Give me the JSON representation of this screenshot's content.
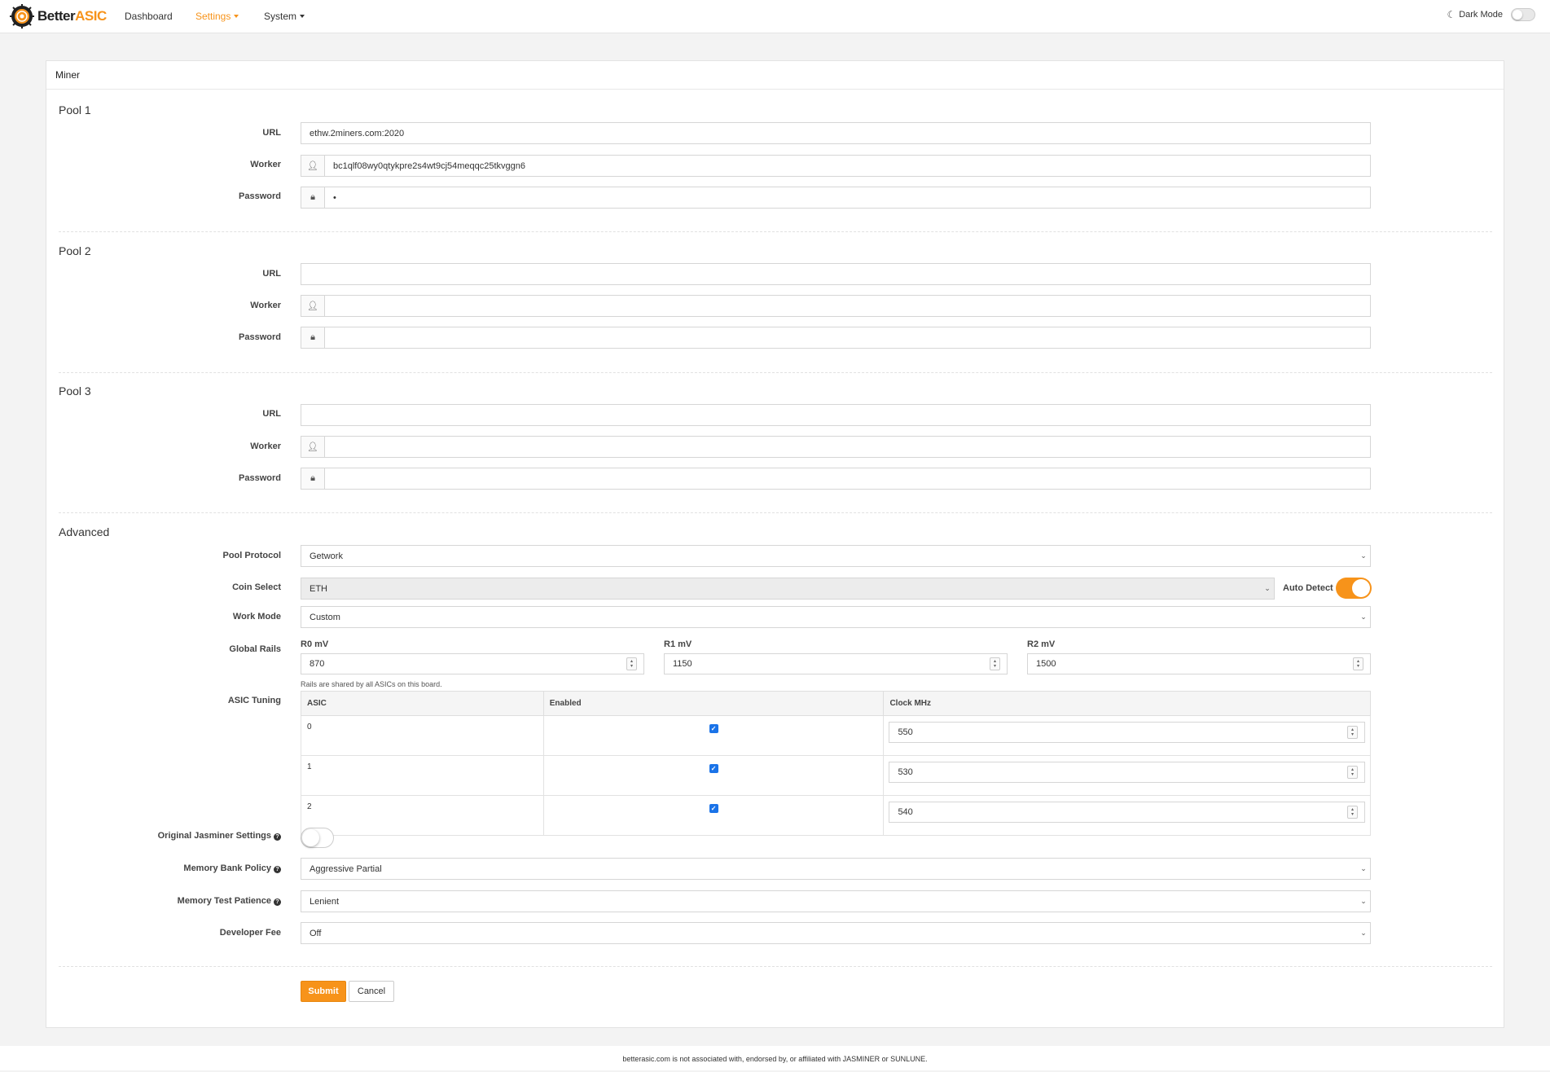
{
  "brand": {
    "name_part1": "Better",
    "name_part2": "ASIC"
  },
  "nav": {
    "dashboard": "Dashboard",
    "settings": "Settings",
    "system": "System",
    "dark_mode": "Dark Mode"
  },
  "card": {
    "title": "Miner"
  },
  "labels": {
    "url": "URL",
    "worker": "Worker",
    "password": "Password"
  },
  "pools": [
    {
      "title": "Pool 1",
      "url": "ethw.2miners.com:2020",
      "worker": "bc1qlf08wy0qtykpre2s4wt9cj54meqqc25tkvggn6",
      "password": "•"
    },
    {
      "title": "Pool 2",
      "url": "",
      "worker": "",
      "password": ""
    },
    {
      "title": "Pool 3",
      "url": "",
      "worker": "",
      "password": ""
    }
  ],
  "advanced": {
    "title": "Advanced",
    "pool_protocol": {
      "label": "Pool Protocol",
      "value": "Getwork"
    },
    "coin_select": {
      "label": "Coin Select",
      "value": "ETH",
      "auto_detect_label": "Auto Detect",
      "auto_detect_on": true
    },
    "work_mode": {
      "label": "Work Mode",
      "value": "Custom"
    },
    "global_rails": {
      "label": "Global Rails",
      "rails": [
        {
          "label": "R0 mV",
          "value": "870"
        },
        {
          "label": "R1 mV",
          "value": "1150"
        },
        {
          "label": "R2 mV",
          "value": "1500"
        }
      ],
      "note": "Rails are shared by all ASICs on this board."
    },
    "asic_tuning": {
      "label": "ASIC Tuning",
      "headers": [
        "ASIC",
        "Enabled",
        "Clock MHz"
      ],
      "rows": [
        {
          "asic": "0",
          "enabled": true,
          "clock": "550"
        },
        {
          "asic": "1",
          "enabled": true,
          "clock": "530"
        },
        {
          "asic": "2",
          "enabled": true,
          "clock": "540"
        }
      ]
    },
    "original_jasminer": {
      "label": "Original Jasminer Settings",
      "on": false
    },
    "memory_bank_policy": {
      "label": "Memory Bank Policy",
      "value": "Aggressive Partial"
    },
    "memory_test_patience": {
      "label": "Memory Test Patience",
      "value": "Lenient"
    },
    "developer_fee": {
      "label": "Developer Fee",
      "value": "Off"
    }
  },
  "buttons": {
    "submit": "Submit",
    "cancel": "Cancel"
  },
  "footer": {
    "text": "betterasic.com is not associated with, endorsed by, or affiliated with JASMINER or SUNLUNE."
  },
  "colors": {
    "accent": "#f7931a",
    "checkbox": "#1a73e8",
    "background": "#f3f3f3"
  },
  "icons": {
    "user": "user-icon",
    "lock": "lock-icon",
    "moon": "moon-icon",
    "chevron": "chevron-down-icon"
  }
}
